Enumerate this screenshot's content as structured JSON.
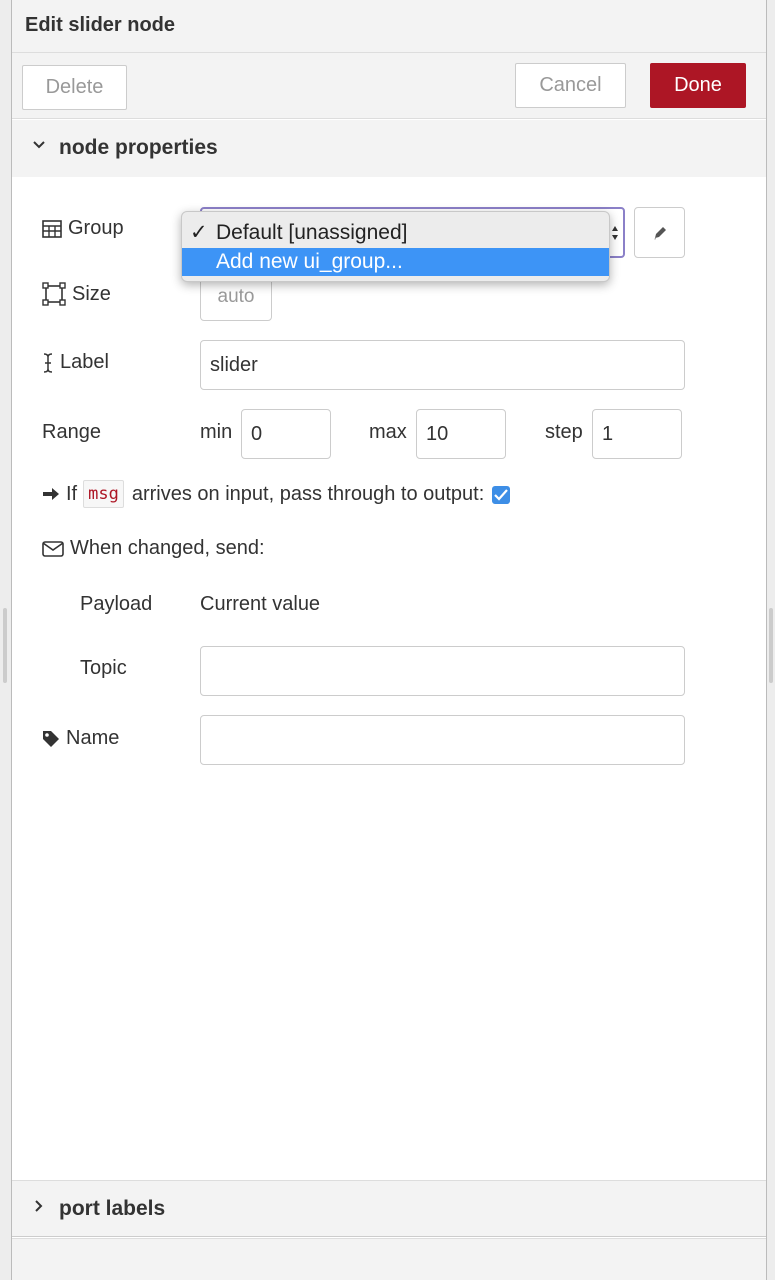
{
  "header": {
    "title": "Edit slider node"
  },
  "toolbar": {
    "delete_label": "Delete",
    "cancel_label": "Cancel",
    "done_label": "Done"
  },
  "sections": {
    "node_properties": "node properties",
    "port_labels": "port labels"
  },
  "group": {
    "label": "Group",
    "options": [
      {
        "label": "Default [unassigned]",
        "checked": true
      },
      {
        "label": "Add new ui_group...",
        "highlighted": true
      }
    ],
    "check_mark": "✓"
  },
  "size": {
    "label": "Size",
    "value": "auto"
  },
  "label_field": {
    "label": "Label",
    "value": "slider"
  },
  "range": {
    "label": "Range",
    "min_label": "min",
    "min_value": "0",
    "max_label": "max",
    "max_value": "10",
    "step_label": "step",
    "step_value": "1"
  },
  "passthrough": {
    "prefix": "If",
    "code": "msg",
    "text": "arrives on input, pass through to output:",
    "checked": true
  },
  "when_changed": {
    "label": "When changed, send:"
  },
  "payload": {
    "label": "Payload",
    "value": "Current value"
  },
  "topic": {
    "label": "Topic",
    "value": ""
  },
  "name": {
    "label": "Name",
    "value": ""
  },
  "colors": {
    "done": "#ad1625",
    "highlight": "#3d94f6",
    "checkbox": "#3d8ee6",
    "code": "#ad1625"
  }
}
